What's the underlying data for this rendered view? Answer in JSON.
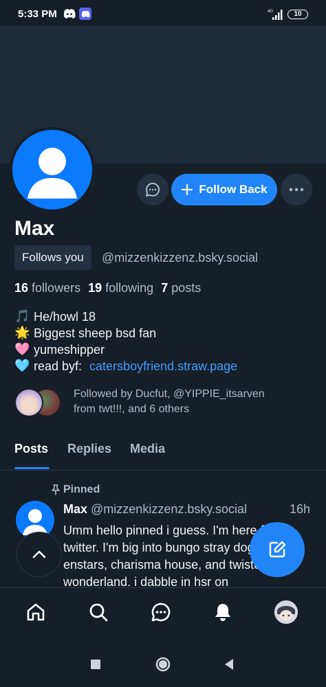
{
  "status_bar": {
    "time": "5:33 PM",
    "icons": [
      "discord-icon",
      "discord-icon"
    ],
    "network_label": "4G",
    "battery": "10"
  },
  "profile": {
    "display_name": "Max",
    "follows_you_label": "Follows you",
    "handle": "@mizzenkizzenz.bsky.social",
    "follow_back_label": "Follow Back",
    "stats": {
      "followers_count": "16",
      "followers_label": "followers",
      "following_count": "19",
      "following_label": "following",
      "posts_count": "7",
      "posts_label": "posts"
    },
    "bio": [
      {
        "emoji": "🎵",
        "text": "He/howl 18"
      },
      {
        "emoji": "🌟",
        "text": "Biggest sheep bsd fan"
      },
      {
        "emoji": "🩷",
        "text": "yumeshipper"
      },
      {
        "emoji": "🩵",
        "text": "read byf: ",
        "link": "catersboyfriend.straw.page"
      }
    ],
    "followed_by_line1": "Followed by Ducfut, @YIPPIE_itsarven",
    "followed_by_line2": "from twt!!!, and 6 others"
  },
  "tabs": [
    "Posts",
    "Replies",
    "Media"
  ],
  "active_tab": "Posts",
  "post": {
    "pinned_label": "Pinned",
    "author": "Max",
    "handle": "@mizzenkizzenz.bsky.social",
    "time": "16h",
    "text": "Umm hello pinned i guess. I'm here from twitter. I'm big into bungo stray dogs, enstars, charisma house, and twisted wonderland. i dabble in hsr on"
  },
  "bottom_nav": [
    "home-icon",
    "search-icon",
    "chat-icon",
    "notifications-icon",
    "profile-avatar"
  ],
  "colors": {
    "background": "#161e27",
    "banner": "#1e2a37",
    "accent": "#2185f8",
    "link": "#3f9dff",
    "muted_text": "#aebbc9"
  }
}
